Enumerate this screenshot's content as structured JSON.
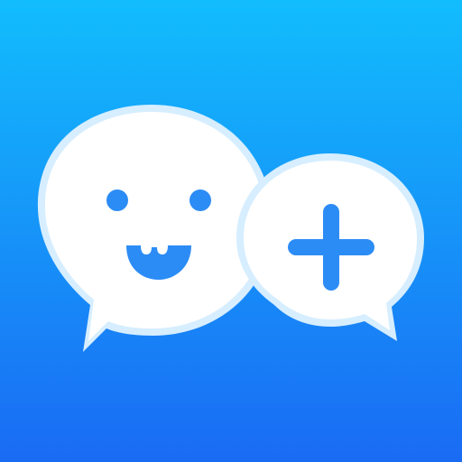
{
  "app_icon": {
    "name": "chat-add-app-icon",
    "icons": [
      "smiley-chat-bubble-icon",
      "plus-chat-bubble-icon"
    ],
    "colors": {
      "gradient_top": "#12BDFD",
      "gradient_bottom": "#1A6BF4",
      "bubble_fill": "#FFFFFF",
      "bubble_outline": "#D6EEFF",
      "face_and_plus": "#2C8CF6"
    }
  }
}
